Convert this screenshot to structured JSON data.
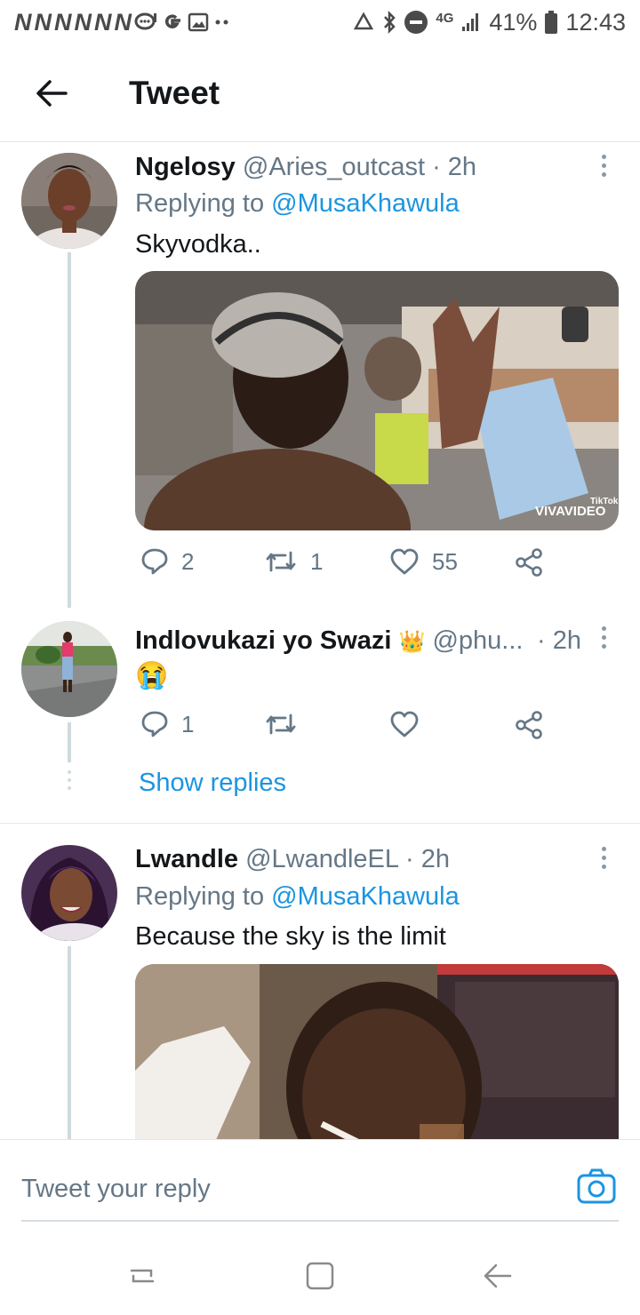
{
  "status_bar": {
    "notification_icons": [
      "N",
      "N",
      "N",
      "N",
      "N",
      "N"
    ],
    "network": "4G",
    "battery": "41%",
    "time": "12:43"
  },
  "header": {
    "title": "Tweet",
    "back_icon": "arrow-left-icon"
  },
  "tweets": [
    {
      "name": "Ngelosy",
      "handle": "@Aries_outcast",
      "time": "· 2h",
      "replying_prefix": "Replying to ",
      "replying_to": "@MusaKhawula",
      "text": "Skyvodka..",
      "media_watermark": "VIVAVIDEO",
      "media_watermark2": "TikTok",
      "actions": {
        "replies": "2",
        "retweets": "1",
        "likes": "55"
      }
    },
    {
      "name": "Indlovukazi yo Swazi",
      "crown": "👑",
      "handle": "@phu...",
      "time": "· 2h",
      "text": "😭",
      "actions": {
        "replies": "1",
        "retweets": "",
        "likes": ""
      },
      "show_replies": "Show replies"
    },
    {
      "name": "Lwandle",
      "handle": "@LwandleEL",
      "time": "· 2h",
      "replying_prefix": "Replying to ",
      "replying_to": "@MusaKhawula",
      "text": "Because the sky is the limit"
    }
  ],
  "composer": {
    "placeholder": "Tweet your reply",
    "camera_icon": "camera-icon"
  },
  "navbar": {
    "icons": [
      "recents-icon",
      "home-icon",
      "back-icon"
    ]
  },
  "colors": {
    "link": "#1b95e0",
    "secondary_text": "#657786",
    "primary_text": "#14171a",
    "divider": "#e1e8ed"
  }
}
